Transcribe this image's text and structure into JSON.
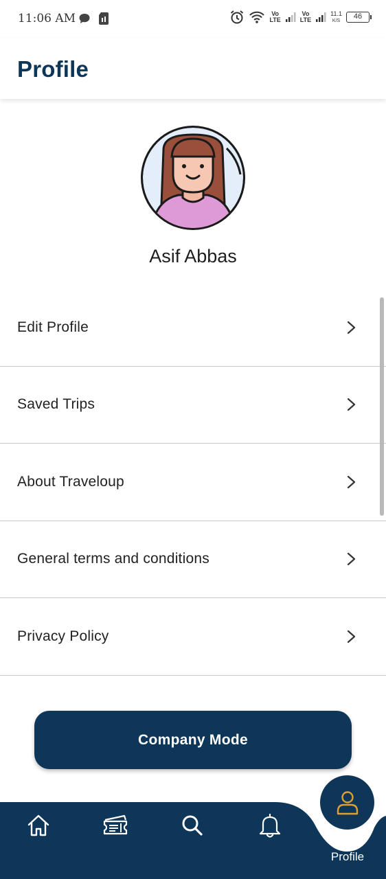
{
  "status_bar": {
    "time": "11:06 AM",
    "network_1": "Vo\nLTE",
    "network_2": "Vo\nLTE",
    "speed_value": "11.1",
    "speed_unit": "K/S",
    "battery": "46",
    "icons": [
      "chat-bubble-icon",
      "sim-card-icon",
      "alarm-icon",
      "wifi-icon",
      "signal-icon",
      "signal-icon"
    ]
  },
  "header": {
    "title": "Profile"
  },
  "profile": {
    "name": "Asif Abbas",
    "avatar_icon": "female-avatar-icon"
  },
  "menu": {
    "items": [
      {
        "label": "Edit Profile",
        "icon": "chevron-right-icon"
      },
      {
        "label": "Saved Trips",
        "icon": "chevron-right-icon"
      },
      {
        "label": "About Traveloup",
        "icon": "chevron-right-icon"
      },
      {
        "label": "General terms and conditions",
        "icon": "chevron-right-icon"
      },
      {
        "label": "Privacy Policy",
        "icon": "chevron-right-icon"
      }
    ]
  },
  "company_button": {
    "label": "Company Mode"
  },
  "bottom_nav": {
    "items": [
      {
        "icon": "home-icon"
      },
      {
        "icon": "ticket-icon"
      },
      {
        "icon": "search-icon"
      },
      {
        "icon": "bell-icon"
      },
      {
        "icon": "user-icon",
        "label": "Profile",
        "active": true
      }
    ]
  },
  "colors": {
    "primary": "#0e3658",
    "accent": "#e0a030",
    "divider": "#c9c9c9"
  }
}
